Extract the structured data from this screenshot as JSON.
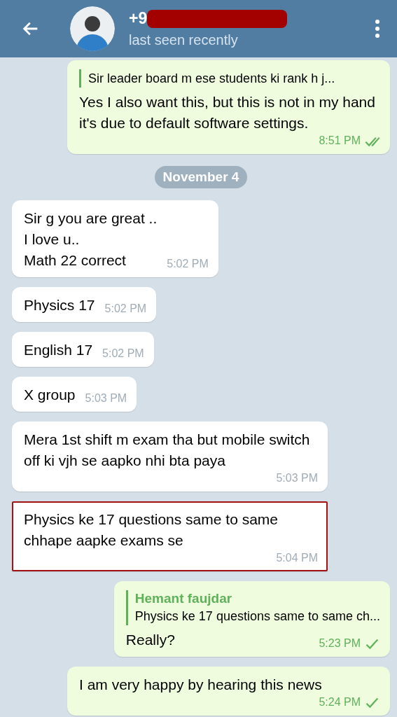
{
  "header": {
    "title": "+9",
    "title_redacted": true,
    "status": "last seen recently"
  },
  "messages": [
    {
      "kind": "outgoing",
      "reply": {
        "text": "Sir leader board m ese students ki rank h j..."
      },
      "text": "Yes I also want this, but this is not in my hand it's due to default software settings.",
      "time": "8:51 PM",
      "read": true
    },
    {
      "kind": "date",
      "text": "November 4"
    },
    {
      "kind": "incoming",
      "text": "Sir g you are great ..\nI love u..\nMath 22 correct",
      "time": "5:02 PM",
      "highlighted": false
    },
    {
      "kind": "incoming",
      "text": "Physics 17",
      "time": "5:02 PM",
      "highlighted": false
    },
    {
      "kind": "incoming",
      "text": "English 17",
      "time": "5:02 PM",
      "highlighted": false
    },
    {
      "kind": "incoming",
      "text": "X group",
      "time": "5:03 PM",
      "highlighted": false
    },
    {
      "kind": "incoming",
      "text": "Mera 1st shift m exam tha but mobile switch off ki vjh se aapko nhi bta paya",
      "time": "5:03 PM",
      "highlighted": false
    },
    {
      "kind": "incoming",
      "text": "Physics ke 17 questions same to same chhape aapke exams se",
      "time": "5:04 PM",
      "highlighted": true
    },
    {
      "kind": "outgoing",
      "reply": {
        "name": "Hemant faujdar",
        "text": "Physics ke 17 questions same to same ch..."
      },
      "text": "Really?",
      "time": "5:23 PM",
      "read": false
    },
    {
      "kind": "outgoing",
      "text": "I am very happy by hearing this news",
      "time": "5:24 PM",
      "read": false
    }
  ]
}
